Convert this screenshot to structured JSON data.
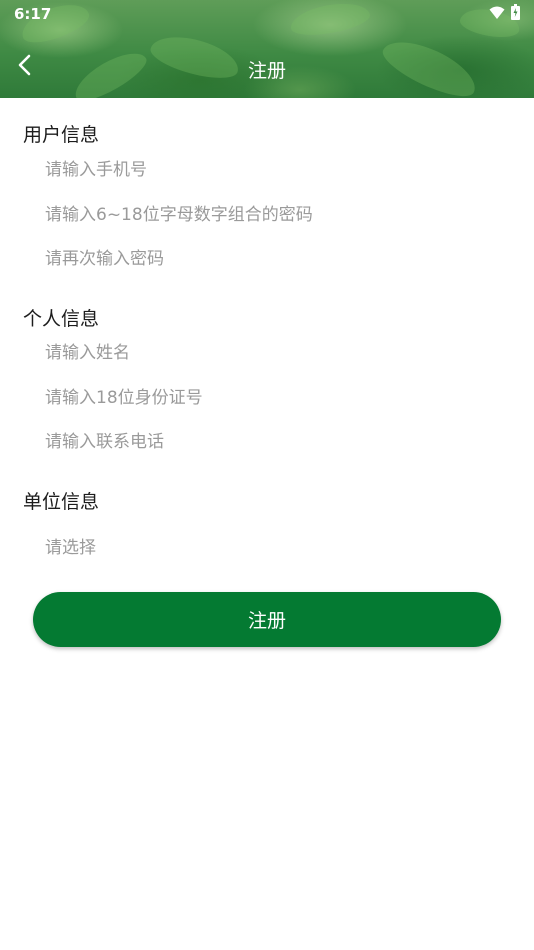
{
  "status_bar": {
    "time": "6:17",
    "icons": [
      "wifi-icon",
      "battery-icon"
    ]
  },
  "header": {
    "title": "注册",
    "back_icon": "back-arrow-icon"
  },
  "sections": {
    "user_info": {
      "title": "用户信息",
      "phone_placeholder": "请输入手机号",
      "password_placeholder": "请输入6~18位字母数字组合的密码",
      "confirm_password_placeholder": "请再次输入密码"
    },
    "personal_info": {
      "title": "个人信息",
      "name_placeholder": "请输入姓名",
      "id_placeholder": "请输入18位身份证号",
      "contact_placeholder": "请输入联系电话"
    },
    "company_info": {
      "title": "单位信息",
      "select_placeholder": "请选择"
    }
  },
  "submit": {
    "label": "注册"
  },
  "colors": {
    "primary": "#047a32",
    "header_green": "#3f8a44",
    "placeholder": "#9a9a9a",
    "section_title": "#1d1d1d"
  }
}
